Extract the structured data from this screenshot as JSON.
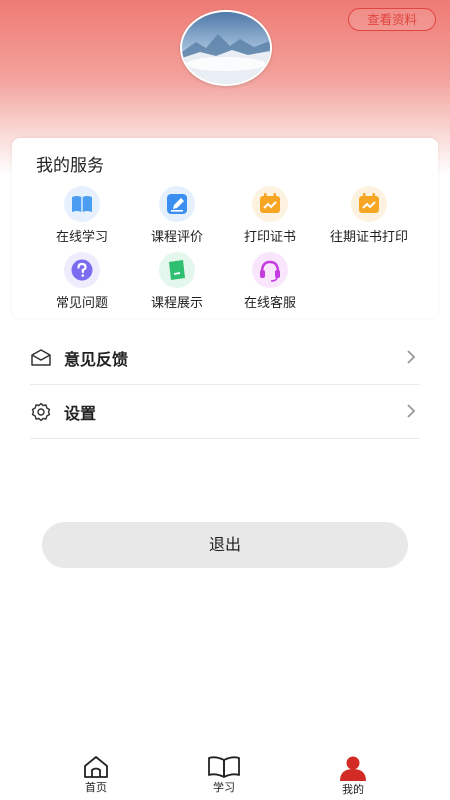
{
  "header": {
    "view_profile_label": "查看资料"
  },
  "services": {
    "title": "我的服务",
    "items": [
      {
        "label": "在线学习",
        "icon": "book-icon",
        "color": "#4a9df0"
      },
      {
        "label": "课程评价",
        "icon": "edit-icon",
        "color": "#3b8ff0"
      },
      {
        "label": "打印证书",
        "icon": "certificate-icon",
        "color": "#f6a623"
      },
      {
        "label": "往期证书打印",
        "icon": "certificate-history-icon",
        "color": "#f6a623"
      },
      {
        "label": "常见问题",
        "icon": "question-icon",
        "color": "#7b6cf0"
      },
      {
        "label": "课程展示",
        "icon": "showcase-icon",
        "color": "#2fbf71"
      },
      {
        "label": "在线客服",
        "icon": "headset-icon",
        "color": "#c43be0"
      }
    ]
  },
  "menu": [
    {
      "label": "意见反馈",
      "icon": "envelope-icon"
    },
    {
      "label": "设置",
      "icon": "gear-icon"
    }
  ],
  "logout_label": "退出",
  "tabbar": {
    "items": [
      {
        "label": "首页",
        "icon": "home-icon"
      },
      {
        "label": "学习",
        "icon": "open-book-icon"
      },
      {
        "label": "我的",
        "icon": "user-icon",
        "active": true
      }
    ],
    "active_color": "#d22a24"
  }
}
